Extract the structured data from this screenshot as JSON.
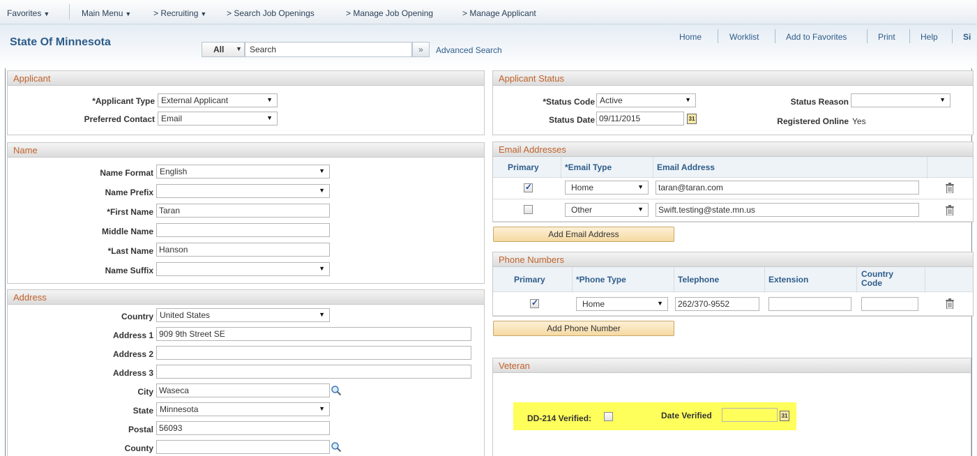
{
  "nav": {
    "favorites": "Favorites",
    "main_menu": "Main Menu",
    "breadcrumb": [
      "> Recruiting",
      "> Search Job Openings",
      "> Manage Job Opening",
      "> Manage Applicant"
    ]
  },
  "header": {
    "org": "State Of Minnesota",
    "links": [
      "Home",
      "Worklist",
      "Add to Favorites",
      "Print",
      "Help",
      "Si"
    ],
    "search": {
      "scope": "All",
      "placeholder": "Search",
      "go_glyph": "»",
      "advanced": "Advanced Search"
    }
  },
  "applicant": {
    "title": "Applicant",
    "type_label": "*Applicant Type",
    "type_value": "External Applicant",
    "contact_label": "Preferred Contact",
    "contact_value": "Email"
  },
  "name": {
    "title": "Name",
    "format_label": "Name Format",
    "format_value": "English",
    "prefix_label": "Name Prefix",
    "prefix_value": "",
    "first_label": "*First Name",
    "first_value": "Taran",
    "middle_label": "Middle Name",
    "middle_value": "",
    "last_label": "*Last Name",
    "last_value": "Hanson",
    "suffix_label": "Name Suffix",
    "suffix_value": ""
  },
  "address": {
    "title": "Address",
    "country_label": "Country",
    "country_value": "United States",
    "addr1_label": "Address 1",
    "addr1_value": "909 9th Street SE",
    "addr2_label": "Address 2",
    "addr2_value": "",
    "addr3_label": "Address 3",
    "addr3_value": "",
    "city_label": "City",
    "city_value": "Waseca",
    "state_label": "State",
    "state_value": "Minnesota",
    "postal_label": "Postal",
    "postal_value": "56093",
    "county_label": "County",
    "county_value": ""
  },
  "status": {
    "title": "Applicant Status",
    "code_label": "*Status Code",
    "code_value": "Active",
    "date_label": "Status Date",
    "date_value": "09/11/2015",
    "reason_label": "Status Reason",
    "reason_value": "",
    "registered_label": "Registered Online",
    "registered_value": "Yes",
    "cal_glyph": "31"
  },
  "email": {
    "title": "Email Addresses",
    "headers": [
      "Primary",
      "*Email Type",
      "Email Address"
    ],
    "rows": [
      {
        "primary": true,
        "type": "Home",
        "address": "taran@taran.com"
      },
      {
        "primary": false,
        "type": "Other",
        "address": "Swift.testing@state.mn.us"
      }
    ],
    "add_label": "Add Email Address"
  },
  "phone": {
    "title": "Phone Numbers",
    "headers": [
      "Primary",
      "*Phone Type",
      "Telephone",
      "Extension",
      "Country Code"
    ],
    "rows": [
      {
        "primary": true,
        "type": "Home",
        "telephone": "262/370-9552",
        "extension": "",
        "country_code": ""
      }
    ],
    "add_label": "Add Phone Number"
  },
  "veteran": {
    "title": "Veteran",
    "dd214_label": "DD-214 Verified:",
    "date_label": "Date Verified",
    "date_value": "",
    "highlight_color": "#ffff5b"
  }
}
